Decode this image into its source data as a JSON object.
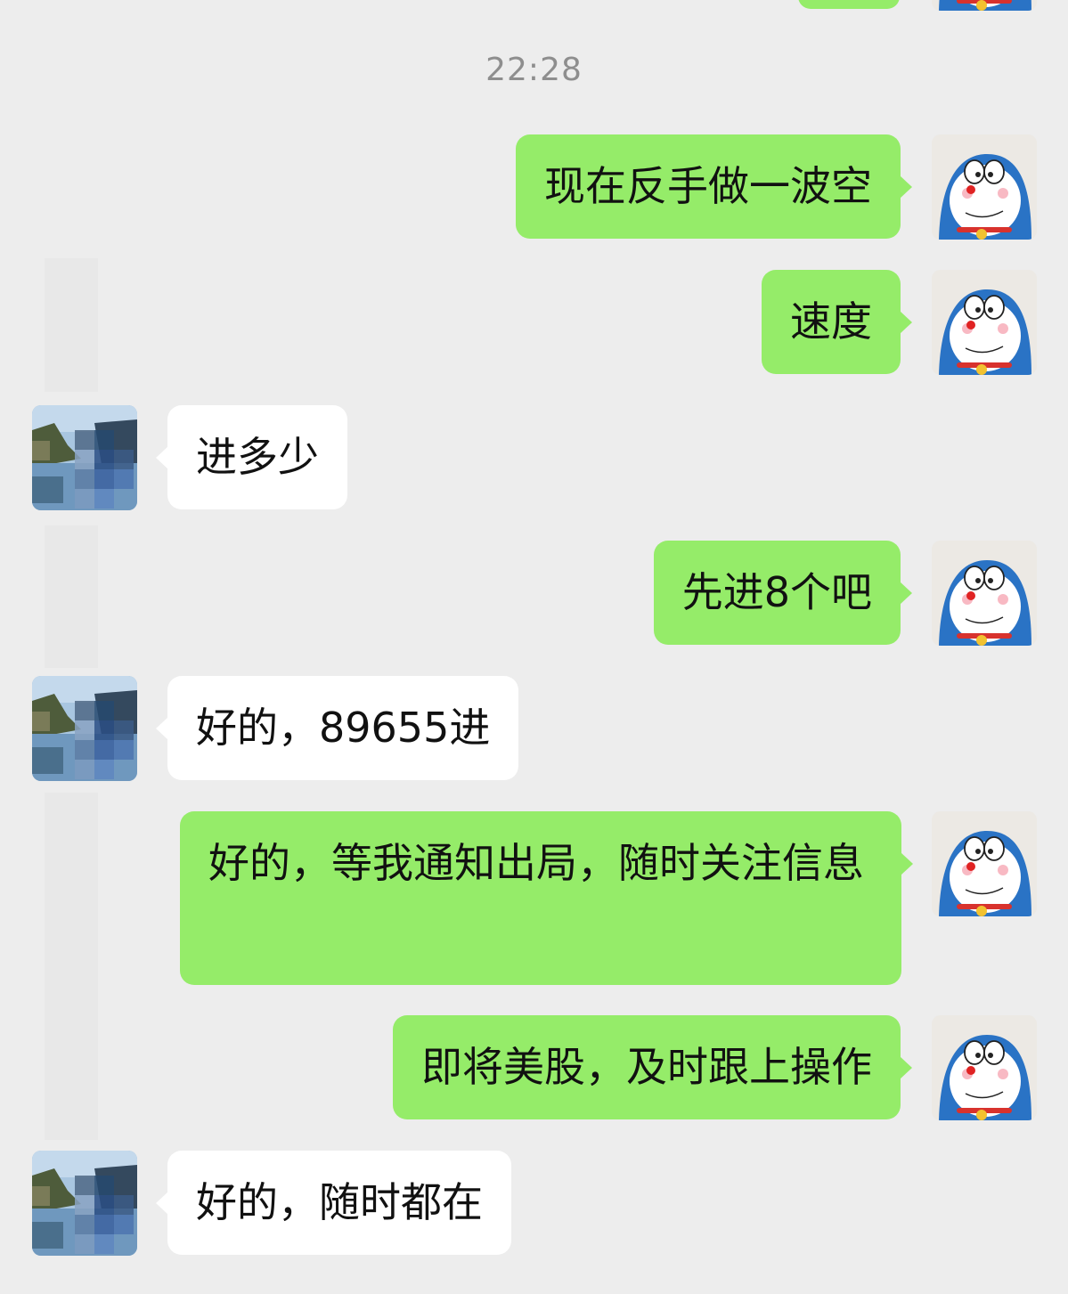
{
  "chat": {
    "timestamp": "22:28",
    "messages": [
      {
        "sender": "self",
        "text": "现在反手做一波空"
      },
      {
        "sender": "self",
        "text": "速度"
      },
      {
        "sender": "other",
        "text": "进多少"
      },
      {
        "sender": "self",
        "text": "先进8个吧"
      },
      {
        "sender": "other",
        "text": "好的，89655进"
      },
      {
        "sender": "self",
        "text": "好的，等我通知出局，随时关注信息"
      },
      {
        "sender": "self",
        "text": "即将美股，及时跟上操作"
      },
      {
        "sender": "other",
        "text": "好的，随时都在"
      }
    ]
  },
  "colors": {
    "background": "#ededed",
    "self_bubble": "#95ec69",
    "other_bubble": "#ffffff",
    "timestamp_text": "#8e8e8e"
  },
  "icons": {
    "self_avatar": "doraemon-avatar-icon",
    "other_avatar": "pixelated-landscape-avatar-icon"
  }
}
